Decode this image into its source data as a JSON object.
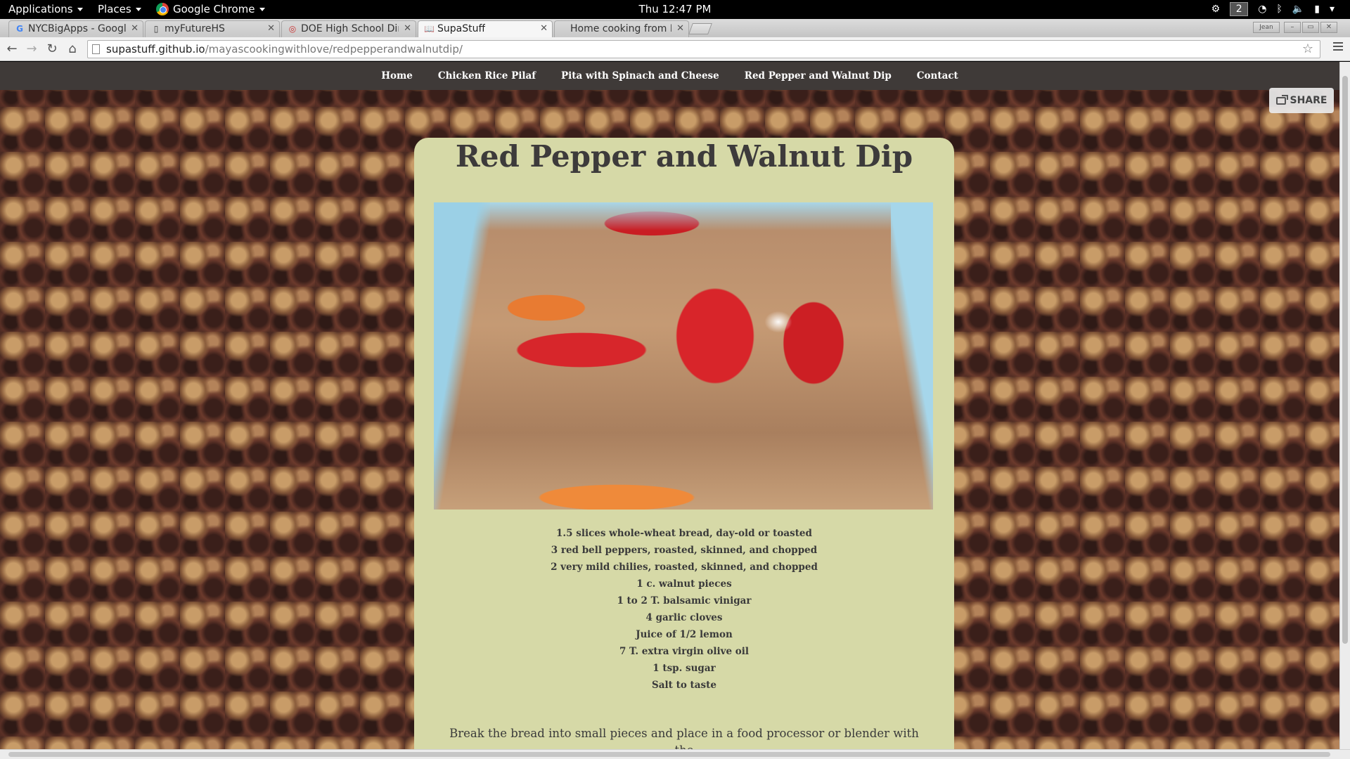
{
  "panel": {
    "applications": "Applications",
    "places": "Places",
    "browser": "Google Chrome",
    "clock": "Thu 12:47 PM",
    "workspace": "2",
    "user_chip": "Jean"
  },
  "tabs": [
    {
      "label": "NYCBigApps - Google",
      "favicon": "google-icon"
    },
    {
      "label": "myFutureHS",
      "favicon": "page-icon"
    },
    {
      "label": "DOE High School Dir",
      "favicon": "globe-icon"
    },
    {
      "label": "SupaStuff",
      "favicon": "book-icon"
    },
    {
      "label": "Home cooking from N",
      "favicon": "none"
    }
  ],
  "address": {
    "host": "supastuff.github.io",
    "path": "/mayascookingwithlove/redpepperandwalnutdip/"
  },
  "site": {
    "nav": [
      "Home",
      "Chicken Rice Pilaf",
      "Pita with Spinach and Cheese",
      "Red Pepper and Walnut Dip",
      "Contact"
    ],
    "share_label": "SHARE",
    "title": "Red Pepper and Walnut Dip",
    "ingredients": [
      "1.5 slices whole-wheat bread, day-old or toasted",
      "3 red bell peppers, roasted, skinned, and chopped",
      "2 very mild chilies, roasted, skinned, and chopped",
      "1 c. walnut pieces",
      "1 to 2 T. balsamic vinigar",
      "4 garlic cloves",
      "Juice of 1/2 lemon",
      "7 T. extra virgin olive oil",
      "1 tsp. sugar",
      "Salt to taste"
    ],
    "instructions": "Break the bread into small pieces and place in a food processor or blender with the"
  },
  "colors": {
    "card_bg": "#d6d9a7",
    "nav_bg": "#3f3a38",
    "title_text": "#3d3b3b"
  }
}
